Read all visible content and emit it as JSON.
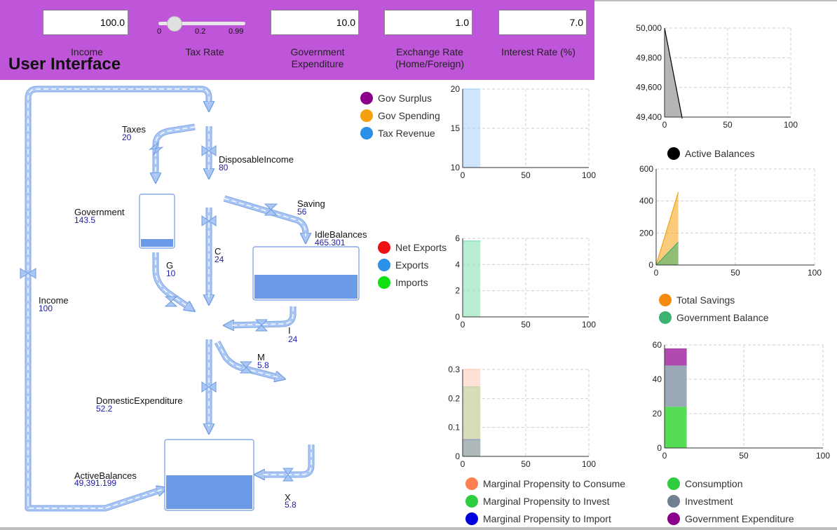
{
  "ui": {
    "title": "User Interface",
    "income": {
      "value": "100.0",
      "label": "Income"
    },
    "tax_rate": {
      "label": "Tax Rate",
      "min": "0",
      "value": "0.2",
      "max": "0.99",
      "fraction": 0.2
    },
    "gov_exp": {
      "value": "10.0",
      "label_line1": "Government",
      "label_line2": "Expenditure"
    },
    "exchange_rate": {
      "value": "1.0",
      "label_line1": "Exchange Rate",
      "label_line2": "(Home/Foreign)"
    },
    "interest_rate": {
      "value": "7.0",
      "label": "Interest Rate (%)"
    }
  },
  "diagram": {
    "taxes": {
      "name": "Taxes",
      "value": "20"
    },
    "disposable_income": {
      "name": "DisposableIncome",
      "value": "80"
    },
    "government": {
      "name": "Government",
      "value": "143.5"
    },
    "saving": {
      "name": "Saving",
      "value": "56"
    },
    "idle_balances": {
      "name": "IdleBalances",
      "value": "465.301"
    },
    "c": {
      "name": "C",
      "value": "24"
    },
    "g": {
      "name": "G",
      "value": "10"
    },
    "income": {
      "name": "Income",
      "value": "100"
    },
    "i": {
      "name": "I",
      "value": "24"
    },
    "m": {
      "name": "M",
      "value": "5.8"
    },
    "domestic_expenditure": {
      "name": "DomesticExpenditure",
      "value": "52.2"
    },
    "active_balances": {
      "name": "ActiveBalances",
      "value": "49,391.199"
    },
    "x": {
      "name": "X",
      "value": "5.8"
    },
    "colors": {
      "pipe": "#a9c6f4",
      "stock_fill": "#6a9ae8",
      "stock_border": "#6e9be6"
    }
  },
  "legends": {
    "gov": [
      {
        "label": "Gov Surplus",
        "color": "#8b008b"
      },
      {
        "label": "Gov Spending",
        "color": "#f5a00f"
      },
      {
        "label": "Tax Revenue",
        "color": "#2b90e8"
      }
    ],
    "trade": [
      {
        "label": "Net Exports",
        "color": "#ee1111"
      },
      {
        "label": "Exports",
        "color": "#2b90e8"
      },
      {
        "label": "Imports",
        "color": "#11e011"
      }
    ],
    "active": [
      {
        "label": "Active Balances",
        "color": "#000000"
      }
    ],
    "savings": [
      {
        "label": "Total Savings",
        "color": "#f58a0f"
      },
      {
        "label": "Government Balance",
        "color": "#3cb371"
      }
    ],
    "mp": [
      {
        "label": "Marginal Propensity to Consume",
        "color": "#ff7f50"
      },
      {
        "label": "Marginal Propensity to Invest",
        "color": "#2ecc40"
      },
      {
        "label": "Marginal Propensity to Import",
        "color": "#0000dd"
      }
    ],
    "expenditure": [
      {
        "label": "Consumption",
        "color": "#2ecc40"
      },
      {
        "label": "Investment",
        "color": "#708090"
      },
      {
        "label": "Government Expenditure",
        "color": "#8b008b"
      }
    ]
  },
  "chart_data": [
    {
      "id": "gov",
      "type": "area",
      "xlim": [
        0,
        100
      ],
      "ylim": [
        10,
        20
      ],
      "xticks": [
        0,
        50,
        100
      ],
      "yticks": [
        10,
        15,
        20
      ],
      "grid": true,
      "series": [
        {
          "name": "Tax Revenue",
          "color": "#a9cdf7",
          "x": [
            0,
            14
          ],
          "y": [
            20,
            20
          ]
        }
      ]
    },
    {
      "id": "trade",
      "type": "area",
      "xlim": [
        0,
        100
      ],
      "ylim": [
        0,
        6
      ],
      "xticks": [
        0,
        50,
        100
      ],
      "yticks": [
        0,
        2,
        4,
        6
      ],
      "grid": true,
      "series": [
        {
          "name": "Imports",
          "color": "#7fe0b0",
          "x": [
            0,
            14
          ],
          "y": [
            5.8,
            5.8
          ]
        }
      ]
    },
    {
      "id": "mp",
      "type": "area",
      "xlim": [
        0,
        100
      ],
      "ylim": [
        0,
        0.3
      ],
      "xticks": [
        0,
        50,
        100
      ],
      "yticks": [
        0,
        0.1,
        0.2,
        0.3
      ],
      "grid": true,
      "series": [
        {
          "name": "Marginal Propensity to Consume",
          "color": "#ffc9b8",
          "x": [
            0,
            14
          ],
          "y": [
            0.3,
            0.3
          ]
        },
        {
          "name": "Marginal Propensity to Invest",
          "color": "#b9d8a0",
          "x": [
            0,
            14
          ],
          "y": [
            0.24,
            0.24
          ]
        },
        {
          "name": "Marginal Propensity to Import",
          "color": "#8b9cc0",
          "x": [
            0,
            14
          ],
          "y": [
            0.058,
            0.058
          ]
        }
      ]
    },
    {
      "id": "active",
      "type": "area",
      "xlim": [
        0,
        100
      ],
      "ylim": [
        49400,
        50000
      ],
      "xticks": [
        0,
        50,
        100
      ],
      "yticks": [
        49400,
        49600,
        49800,
        50000
      ],
      "grid": true,
      "series": [
        {
          "name": "Active Balances",
          "color": "#000000",
          "x": [
            0,
            14
          ],
          "y": [
            50000,
            49391.199
          ]
        }
      ]
    },
    {
      "id": "savings",
      "type": "area",
      "xlim": [
        0,
        100
      ],
      "ylim": [
        0,
        600
      ],
      "xticks": [
        0,
        50,
        100
      ],
      "yticks": [
        0,
        200,
        400,
        600
      ],
      "grid": true,
      "series": [
        {
          "name": "Total Savings",
          "color": "#f5a00f",
          "x": [
            0,
            14
          ],
          "y": [
            0,
            455
          ]
        },
        {
          "name": "Government Balance",
          "color": "#3cb371",
          "x": [
            0,
            14
          ],
          "y": [
            0,
            143.5
          ]
        }
      ]
    },
    {
      "id": "expenditure",
      "type": "bar",
      "stacked": true,
      "xlim": [
        0,
        100
      ],
      "ylim": [
        0,
        60
      ],
      "xticks": [
        0,
        50,
        100
      ],
      "yticks": [
        0,
        20,
        40,
        60
      ],
      "grid": true,
      "x_span": [
        0,
        14
      ],
      "series": [
        {
          "name": "Consumption",
          "color": "#55dd55",
          "value": 24
        },
        {
          "name": "Investment",
          "color": "#9ba8b8",
          "value": 24
        },
        {
          "name": "Government Expenditure",
          "color": "#b04ab0",
          "value": 10
        }
      ]
    }
  ]
}
